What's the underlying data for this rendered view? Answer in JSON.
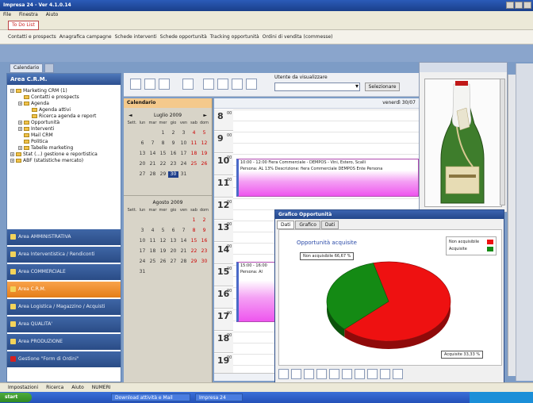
{
  "window": {
    "title": "Impresa 24 - Ver 4.1.0.14"
  },
  "menu": [
    "File",
    "Finestra",
    "Aiuto"
  ],
  "todo": {
    "label": "To Do List"
  },
  "bookmarks": [
    "Contatti e prospects",
    "Anagrafica campagne",
    "Schede interventi",
    "Schede opportunità",
    "Tracking opportunità",
    "Ordini di vendita (commesse)"
  ],
  "left": {
    "tab_label": "Calendario",
    "header": "Area C.R.M.",
    "tree": [
      {
        "label": "Marketing CRM (1)",
        "level": 0,
        "exp": true
      },
      {
        "label": "Contatti e prospects",
        "level": 1,
        "exp": false
      },
      {
        "label": "Agenda",
        "level": 1,
        "exp": true
      },
      {
        "label": "Agenda attivi",
        "level": 2,
        "exp": false
      },
      {
        "label": "Ricerca agenda e report",
        "level": 2,
        "exp": false
      },
      {
        "label": "Opportunità",
        "level": 1,
        "exp": true
      },
      {
        "label": "Interventi",
        "level": 1,
        "exp": true
      },
      {
        "label": "Mail CRM",
        "level": 1,
        "exp": false
      },
      {
        "label": "Politica",
        "level": 1,
        "exp": false
      },
      {
        "label": "Tabelle marketing",
        "level": 1,
        "exp": true
      },
      {
        "label": "Stat (...) gestione e reportistica",
        "level": 0,
        "exp": true
      },
      {
        "label": "ABF (statistiche mercato)",
        "level": 0,
        "exp": true
      }
    ],
    "areas": [
      {
        "label": "Area AMMINISTRATIVA",
        "active": false
      },
      {
        "label": "Area Interventistica / Rendiconti",
        "active": false
      },
      {
        "label": "Area COMMERCIALE",
        "active": false
      },
      {
        "label": "Area C.R.M.",
        "active": true
      },
      {
        "label": "Area Logistica / Magazzino / Acquisti",
        "active": false
      },
      {
        "label": "Area QUALITA'",
        "active": false
      },
      {
        "label": "Area PRODUZIONE",
        "active": false
      },
      {
        "label": "Gestione \"Form di Ordini\"",
        "active": false
      }
    ]
  },
  "toolbar": {
    "resources_label": "Utente da visualizzare",
    "select_value": "",
    "button": "Selezionare"
  },
  "calendar": {
    "header": "Calendario",
    "month1": "Luglio 2009",
    "month2": "Agosto 2009",
    "dow": [
      "Sett.",
      "lun",
      "mar",
      "mer",
      "gio",
      "ven",
      "sab",
      "dom"
    ],
    "weeks1": [
      [
        "",
        "",
        "",
        "1",
        "2",
        "3",
        "4",
        "5"
      ],
      [
        "",
        "6",
        "7",
        "8",
        "9",
        "10",
        "11",
        "12"
      ],
      [
        "",
        "13",
        "14",
        "15",
        "16",
        "17",
        "18",
        "19"
      ],
      [
        "",
        "20",
        "21",
        "22",
        "23",
        "24",
        "25",
        "26"
      ],
      [
        "",
        "27",
        "28",
        "29",
        "30",
        "31",
        "",
        ""
      ]
    ],
    "weeks2": [
      [
        "",
        "",
        "",
        "",
        "",
        "",
        "1",
        "2"
      ],
      [
        "",
        "3",
        "4",
        "5",
        "6",
        "7",
        "8",
        "9"
      ],
      [
        "",
        "10",
        "11",
        "12",
        "13",
        "14",
        "15",
        "16"
      ],
      [
        "",
        "17",
        "18",
        "19",
        "20",
        "21",
        "22",
        "23"
      ],
      [
        "",
        "24",
        "25",
        "26",
        "27",
        "28",
        "29",
        "30"
      ],
      [
        "",
        "31",
        "",
        "",
        "",
        "",
        "",
        ""
      ]
    ],
    "selected_day": "30"
  },
  "day": {
    "date": "venerdì 30/07",
    "hours": [
      "8",
      "9",
      "10",
      "11",
      "12",
      "13",
      "14",
      "15",
      "16",
      "17",
      "18",
      "19"
    ],
    "minutes": "00",
    "appt1": {
      "line1": "10:00 - 12:00 Fiera Commerciale - DEMPOS - Vini, Estero, Scalli",
      "line2": "Persona: AL 13% Descrizione: fiera Commerciale DEMPOS Ente Persona"
    },
    "appt2": {
      "line1": "15:00 - 16:00",
      "line2": "Persona: Al"
    }
  },
  "opportunities": {
    "window_title": "Grafico Opportunità",
    "tabs": [
      "Dati",
      "Grafico",
      "Dati"
    ],
    "chart_title": "Opportunità acquisite",
    "chart_data": {
      "type": "pie",
      "title": "Opportunità acquisite",
      "series": [
        {
          "name": "Non acquisibile",
          "value": 66.67,
          "color": "#ee1111"
        },
        {
          "name": "Acquisite",
          "value": 33.33,
          "color": "#148a14"
        }
      ],
      "labels": [
        "Non acquisibile 66,67 %",
        "Acquisite 33,33 %"
      ],
      "legend_position": "top-right"
    }
  },
  "status": [
    "Impostazioni",
    "Ricerca",
    "Aiuto",
    "NUMERI"
  ],
  "taskbar": {
    "start": "start",
    "items": [
      "Download attività e Mail",
      "Impresa 24"
    ]
  },
  "colors": {
    "title_blue": "#2b5bb8",
    "active_area": "#f39234",
    "appt_pink": "#ee55ee"
  }
}
